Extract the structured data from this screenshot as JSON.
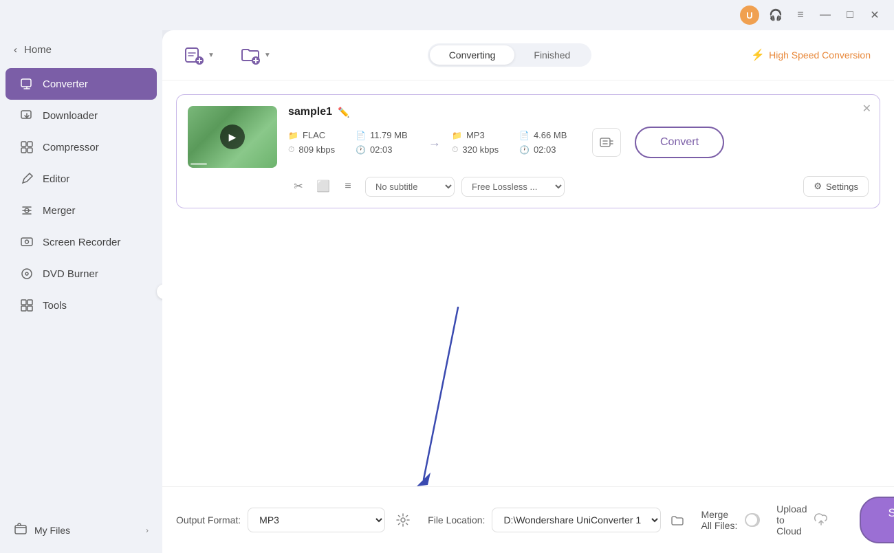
{
  "titlebar": {
    "minimize": "—",
    "maximize": "□",
    "close": "✕",
    "user_initials": "U"
  },
  "sidebar": {
    "home_label": "Home",
    "home_arrow": "‹",
    "items": [
      {
        "id": "converter",
        "label": "Converter",
        "active": true
      },
      {
        "id": "downloader",
        "label": "Downloader",
        "active": false
      },
      {
        "id": "compressor",
        "label": "Compressor",
        "active": false
      },
      {
        "id": "editor",
        "label": "Editor",
        "active": false
      },
      {
        "id": "merger",
        "label": "Merger",
        "active": false
      },
      {
        "id": "screen-recorder",
        "label": "Screen Recorder",
        "active": false
      },
      {
        "id": "dvd-burner",
        "label": "DVD Burner",
        "active": false
      },
      {
        "id": "tools",
        "label": "Tools",
        "active": false
      }
    ],
    "footer_label": "My Files",
    "footer_arrow": "›",
    "collapse_arrow": "‹"
  },
  "toolbar": {
    "tab_converting": "Converting",
    "tab_finished": "Finished",
    "speed_label": "High Speed Conversion",
    "add_file_tooltip": "Add file",
    "add_folder_tooltip": "Add folder"
  },
  "file_card": {
    "filename": "sample1",
    "source_format": "FLAC",
    "source_size": "11.79 MB",
    "source_bitrate": "809 kbps",
    "source_duration": "02:03",
    "target_format": "MP3",
    "target_size": "4.66 MB",
    "target_bitrate": "320 kbps",
    "target_duration": "02:03",
    "convert_btn": "Convert",
    "subtitle_placeholder": "No subtitle",
    "audio_placeholder": "Free Lossless ...",
    "settings_label": "Settings"
  },
  "bottom_bar": {
    "output_format_label": "Output Format:",
    "output_format_value": "MP3",
    "file_location_label": "File Location:",
    "file_location_value": "D:\\Wondershare UniConverter 1",
    "merge_label": "Merge All Files:",
    "upload_label": "Upload to Cloud",
    "start_btn": "Start All"
  }
}
